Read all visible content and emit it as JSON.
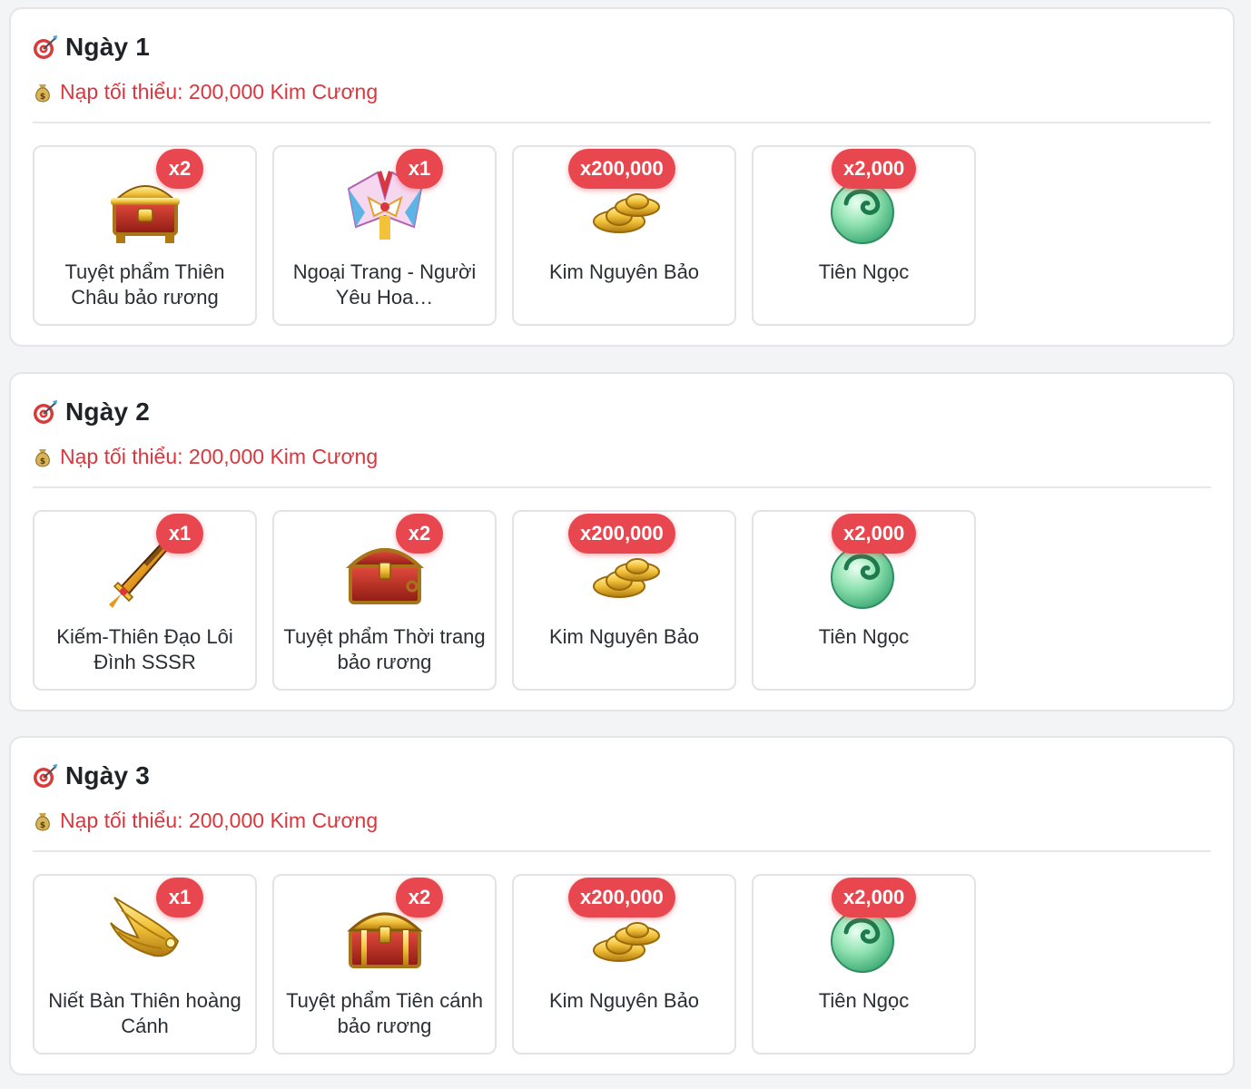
{
  "colors": {
    "accent_red": "#e8474f",
    "min_text": "#d9363e",
    "title": "#1f2328"
  },
  "icons": {
    "title": "target-dart-icon",
    "min_requirement": "money-bag-icon"
  },
  "days": [
    {
      "title": "Ngày 1",
      "min_requirement": "Nạp tối thiểu: 200,000 Kim Cương",
      "rewards": [
        {
          "qty": "x2",
          "name": "Tuyệt phẩm Thiên Châu bảo rương",
          "icon": "treasure-chest-red-icon"
        },
        {
          "qty": "x1",
          "name": "Ngoại Trang - Người Yêu Hoa…",
          "icon": "costume-icon"
        },
        {
          "qty": "x200,000",
          "name": "Kim Nguyên Bảo",
          "icon": "gold-ingot-icon"
        },
        {
          "qty": "x2,000",
          "name": "Tiên Ngọc",
          "icon": "jade-icon"
        }
      ]
    },
    {
      "title": "Ngày 2",
      "min_requirement": "Nạp tối thiểu: 200,000 Kim Cương",
      "rewards": [
        {
          "qty": "x1",
          "name": "Kiếm-Thiên Đạo Lôi Đình SSSR",
          "icon": "sword-icon"
        },
        {
          "qty": "x2",
          "name": "Tuyệt phẩm Thời trang bảo rương",
          "icon": "treasure-chest-icon"
        },
        {
          "qty": "x200,000",
          "name": "Kim Nguyên Bảo",
          "icon": "gold-ingot-icon"
        },
        {
          "qty": "x2,000",
          "name": "Tiên Ngọc",
          "icon": "jade-icon"
        }
      ]
    },
    {
      "title": "Ngày 3",
      "min_requirement": "Nạp tối thiểu: 200,000 Kim Cương",
      "rewards": [
        {
          "qty": "x1",
          "name": "Niết Bàn Thiên hoàng Cánh",
          "icon": "golden-wings-icon"
        },
        {
          "qty": "x2",
          "name": "Tuyệt phẩm Tiên cánh bảo rương",
          "icon": "treasure-chest-icon"
        },
        {
          "qty": "x200,000",
          "name": "Kim Nguyên Bảo",
          "icon": "gold-ingot-icon"
        },
        {
          "qty": "x2,000",
          "name": "Tiên Ngọc",
          "icon": "jade-icon"
        }
      ]
    }
  ]
}
